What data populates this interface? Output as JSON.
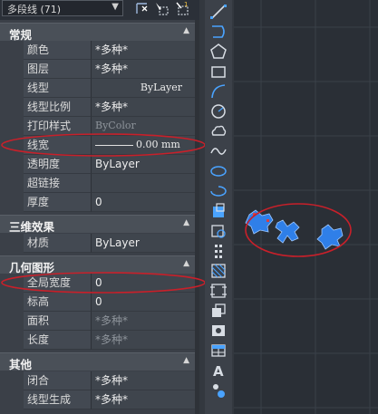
{
  "selector": {
    "label": "多段线 (71)",
    "dropdown_icon": "chevron-down-icon"
  },
  "toolbar_buttons": [
    "quick-select-icon",
    "select-objects-icon",
    "toggle-pickadd-icon"
  ],
  "categories": [
    {
      "title": "常规",
      "rows": [
        {
          "name": "颜色",
          "value": "*多种*"
        },
        {
          "name": "图层",
          "value": "*多种*"
        },
        {
          "name": "线型",
          "value": "ByLayer"
        },
        {
          "name": "线型比例",
          "value": "*多种*"
        },
        {
          "name": "打印样式",
          "value": "ByColor"
        },
        {
          "name": "线宽",
          "value": "0.00 mm"
        },
        {
          "name": "透明度",
          "value": "ByLayer"
        },
        {
          "name": "超链接",
          "value": ""
        },
        {
          "name": "厚度",
          "value": "0"
        }
      ]
    },
    {
      "title": "三维效果",
      "rows": [
        {
          "name": "材质",
          "value": "ByLayer"
        }
      ]
    },
    {
      "title": "几何图形",
      "rows": [
        {
          "name": "全局宽度",
          "value": "0"
        },
        {
          "name": "标高",
          "value": "0"
        },
        {
          "name": "面积",
          "value": "*多种*"
        },
        {
          "name": "长度",
          "value": "*多种*"
        }
      ]
    },
    {
      "title": "其他",
      "rows": [
        {
          "name": "闭合",
          "value": "*多种*"
        },
        {
          "name": "线型生成",
          "value": "*多种*"
        }
      ]
    }
  ],
  "draw_tools": [
    "line-icon",
    "polyline-icon",
    "polygon-icon",
    "rectangle-icon",
    "arc-icon",
    "circle-icon",
    "revision-cloud-icon",
    "spline-icon",
    "ellipse-icon",
    "ellipse-arc-icon",
    "insert-block-icon",
    "make-block-icon",
    "point-icon",
    "hatch-icon",
    "gradient-icon",
    "region-icon",
    "wipeout-icon",
    "table-icon",
    "multiline-text-icon",
    "add-selected-icon"
  ],
  "colors": {
    "annotation": "#c8202a",
    "selection": "#2f7fe8",
    "canvas": "#2a2f36"
  }
}
